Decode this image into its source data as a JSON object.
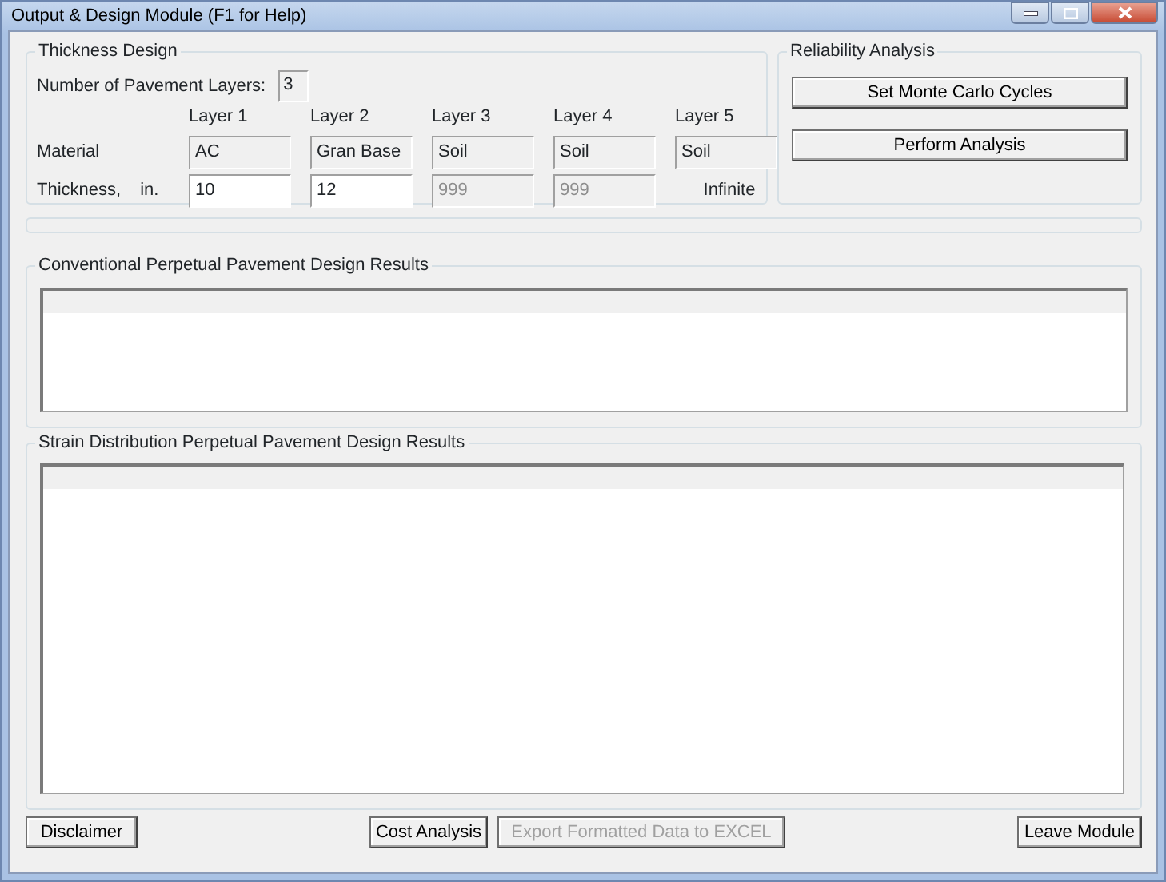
{
  "window": {
    "title": "Output & Design Module (F1 for Help)"
  },
  "thickness_design": {
    "title": "Thickness Design",
    "layer_count_label": "Number of Pavement Layers:",
    "layer_count": "3",
    "material_label": "Material",
    "thickness_label": "Thickness,",
    "unit": "in.",
    "layers": [
      {
        "header": "Layer 1",
        "material": "AC",
        "thickness": "10",
        "kind": "input"
      },
      {
        "header": "Layer 2",
        "material": "Gran Base",
        "thickness": "12",
        "kind": "input"
      },
      {
        "header": "Layer 3",
        "material": "Soil",
        "thickness": "999",
        "kind": "disabled"
      },
      {
        "header": "Layer 4",
        "material": "Soil",
        "thickness": "999",
        "kind": "disabled"
      },
      {
        "header": "Layer 5",
        "material": "Soil",
        "thickness": "Infinite",
        "kind": "text"
      }
    ]
  },
  "reliability_analysis": {
    "title": "Reliability Analysis",
    "buttons": [
      "Set Monte Carlo Cycles",
      "Perform Analysis"
    ]
  },
  "conventional_results": {
    "title": "Conventional Perpetual Pavement Design Results"
  },
  "strain_results": {
    "title": "Strain Distribution Perpetual Pavement Design Results"
  },
  "footer_buttons": [
    {
      "label": "Disclaimer",
      "disabled": false
    },
    {
      "label": "Cost Analysis",
      "disabled": false
    },
    {
      "label": "Export Formatted Data to EXCEL",
      "disabled": true
    },
    {
      "label": "Leave Module",
      "disabled": false
    }
  ]
}
